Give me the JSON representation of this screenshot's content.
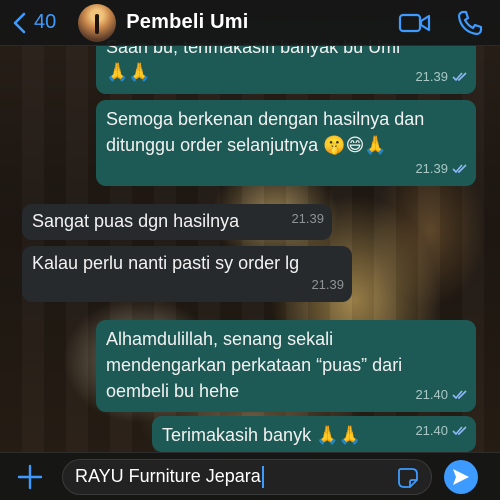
{
  "header": {
    "back_count": "40",
    "contact_name": "Pembeli Umi"
  },
  "messages": [
    {
      "direction": "out",
      "text": "Saan bu, terimakasih banyak bu Umi",
      "emoji": "🙏🙏",
      "time": "21.39"
    },
    {
      "direction": "out",
      "text": "Semoga berkenan dengan hasilnya dan ditunggu order selanjutnya",
      "emoji": "🤫😄🙏",
      "time": "21.39"
    },
    {
      "direction": "in",
      "text": "Sangat puas dgn hasilnya",
      "time": "21.39"
    },
    {
      "direction": "in",
      "text": "Kalau perlu nanti pasti sy order lg",
      "time": "21.39"
    },
    {
      "direction": "out",
      "text": "Alhamdulillah, senang sekali mendengarkan perkataan “puas” dari oembeli bu hehe",
      "time": "21.40"
    },
    {
      "direction": "out",
      "text": "Terimakasih banyk",
      "emoji": "🙏🙏",
      "time": "21.40"
    }
  ],
  "composer": {
    "value": "RAYU Furniture Jepara"
  },
  "colors": {
    "accent": "#3d9bff",
    "outgoing_bubble": "#1e5a55",
    "incoming_bubble": "#262a2d"
  },
  "icons": [
    "chevron-left-icon",
    "video-call-icon",
    "phone-icon",
    "plus-icon",
    "sticker-icon",
    "send-icon",
    "double-check-icon"
  ]
}
